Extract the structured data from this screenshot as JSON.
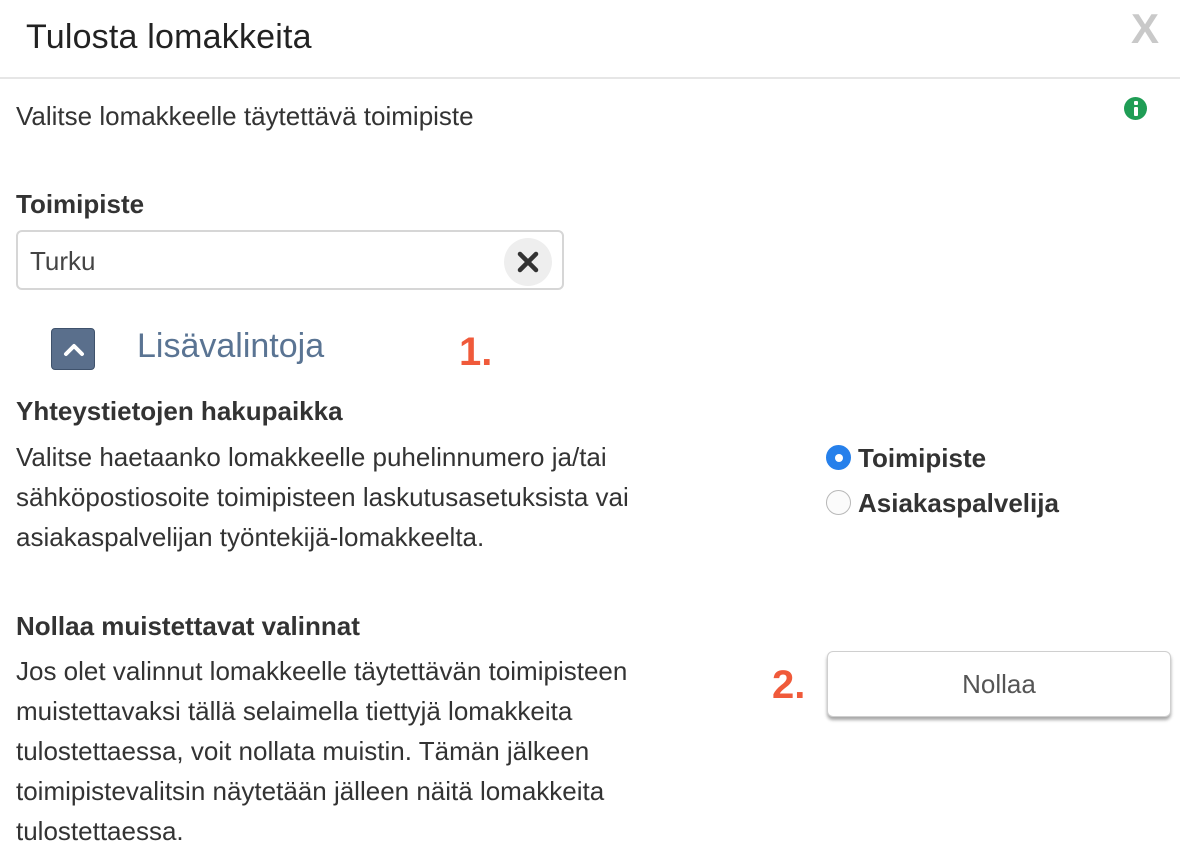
{
  "dialog": {
    "title": "Tulosta lomakkeita",
    "close_label": "X"
  },
  "intro": {
    "text": "Valitse lomakkeelle täytettävä toimipiste",
    "info_icon": "info-circle-icon",
    "info_color": "#1f9d55"
  },
  "office_field": {
    "label": "Toimipiste",
    "value": "Turku",
    "clear_icon": "clear-x-icon"
  },
  "more_options": {
    "label": "Lisävalintoja",
    "toggle_icon": "chevron-up-icon",
    "toggle_color": "#5a6f8c"
  },
  "annotations": {
    "marker_1": "1.",
    "marker_2": "2.",
    "color": "#f05a3a"
  },
  "contact_source": {
    "heading": "Yhteystietojen hakupaikka",
    "description_lines": [
      "Valitse haetaanko lomakkeelle puhelinnumero ja/tai",
      "sähköpostiosoite toimipisteen laskutusasetuksista vai",
      "asiakaspalvelijan työntekijä-lomakkeelta."
    ],
    "options": [
      {
        "label": "Toimipiste",
        "checked": true
      },
      {
        "label": "Asiakaspalvelija",
        "checked": false
      }
    ],
    "radio_color": "#2680eb"
  },
  "reset": {
    "heading": "Nollaa muistettavat valinnat",
    "description_lines": [
      "Jos olet valinnut lomakkeelle täytettävän toimipisteen",
      "muistettavaksi tällä selaimella tiettyjä lomakkeita",
      "tulostettaessa, voit nollata muistin. Tämän jälkeen",
      "toimipistevalitsin näytetään jälleen näitä lomakkeita",
      "tulostettaessa."
    ],
    "button_label": "Nollaa"
  }
}
